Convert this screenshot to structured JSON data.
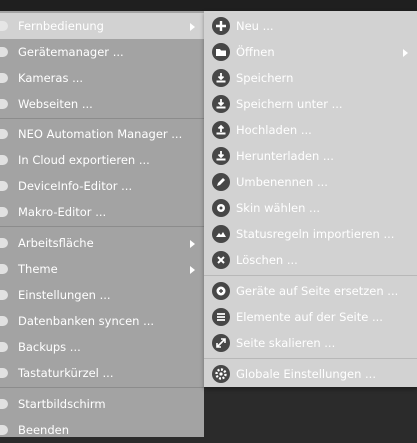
{
  "left_menu": {
    "items": [
      {
        "label": "Fernbedienung",
        "submenu": true
      },
      {
        "label": "Gerätemanager ..."
      },
      {
        "label": "Kameras ..."
      },
      {
        "label": "Webseiten ..."
      },
      {
        "label": "NEO Automation Manager ..."
      },
      {
        "label": "In Cloud exportieren ..."
      },
      {
        "label": "DeviceInfo-Editor ..."
      },
      {
        "label": "Makro-Editor ..."
      },
      {
        "label": "Arbeitsfläche",
        "submenu": true
      },
      {
        "label": "Theme",
        "submenu": true
      },
      {
        "label": "Einstellungen ..."
      },
      {
        "label": "Datenbanken syncen ..."
      },
      {
        "label": "Backups ..."
      },
      {
        "label": "Tastaturkürzel ..."
      },
      {
        "label": "Startbildschirm"
      },
      {
        "label": "Beenden"
      }
    ]
  },
  "submenu": {
    "items": [
      {
        "label": "Neu ...",
        "icon": "plus-icon"
      },
      {
        "label": "Öffnen",
        "icon": "folder-icon",
        "submenu": true
      },
      {
        "label": "Speichern",
        "icon": "save-icon"
      },
      {
        "label": "Speichern unter ...",
        "icon": "save-as-icon"
      },
      {
        "label": "Hochladen ...",
        "icon": "upload-icon"
      },
      {
        "label": "Herunterladen ...",
        "icon": "download-icon"
      },
      {
        "label": "Umbenennen ...",
        "icon": "pencil-icon"
      },
      {
        "label": "Skin wählen ...",
        "icon": "skin-icon"
      },
      {
        "label": "Statusregeln importieren ...",
        "icon": "import-icon"
      },
      {
        "label": "Löschen ...",
        "icon": "delete-icon"
      },
      {
        "label": "Geräte auf Seite ersetzen ...",
        "icon": "replace-icon"
      },
      {
        "label": "Elemente auf der Seite ...",
        "icon": "list-icon"
      },
      {
        "label": "Seite skalieren ...",
        "icon": "scale-icon"
      },
      {
        "label": "Globale Einstellungen ...",
        "icon": "gear-icon"
      }
    ]
  },
  "colors": {
    "left_menu_bg": "#a3a3a3",
    "submenu_bg": "#d2d2d2",
    "highlight_bg": "#d2d2d2",
    "icon_bg": "#474747",
    "text": "#ffffff"
  }
}
